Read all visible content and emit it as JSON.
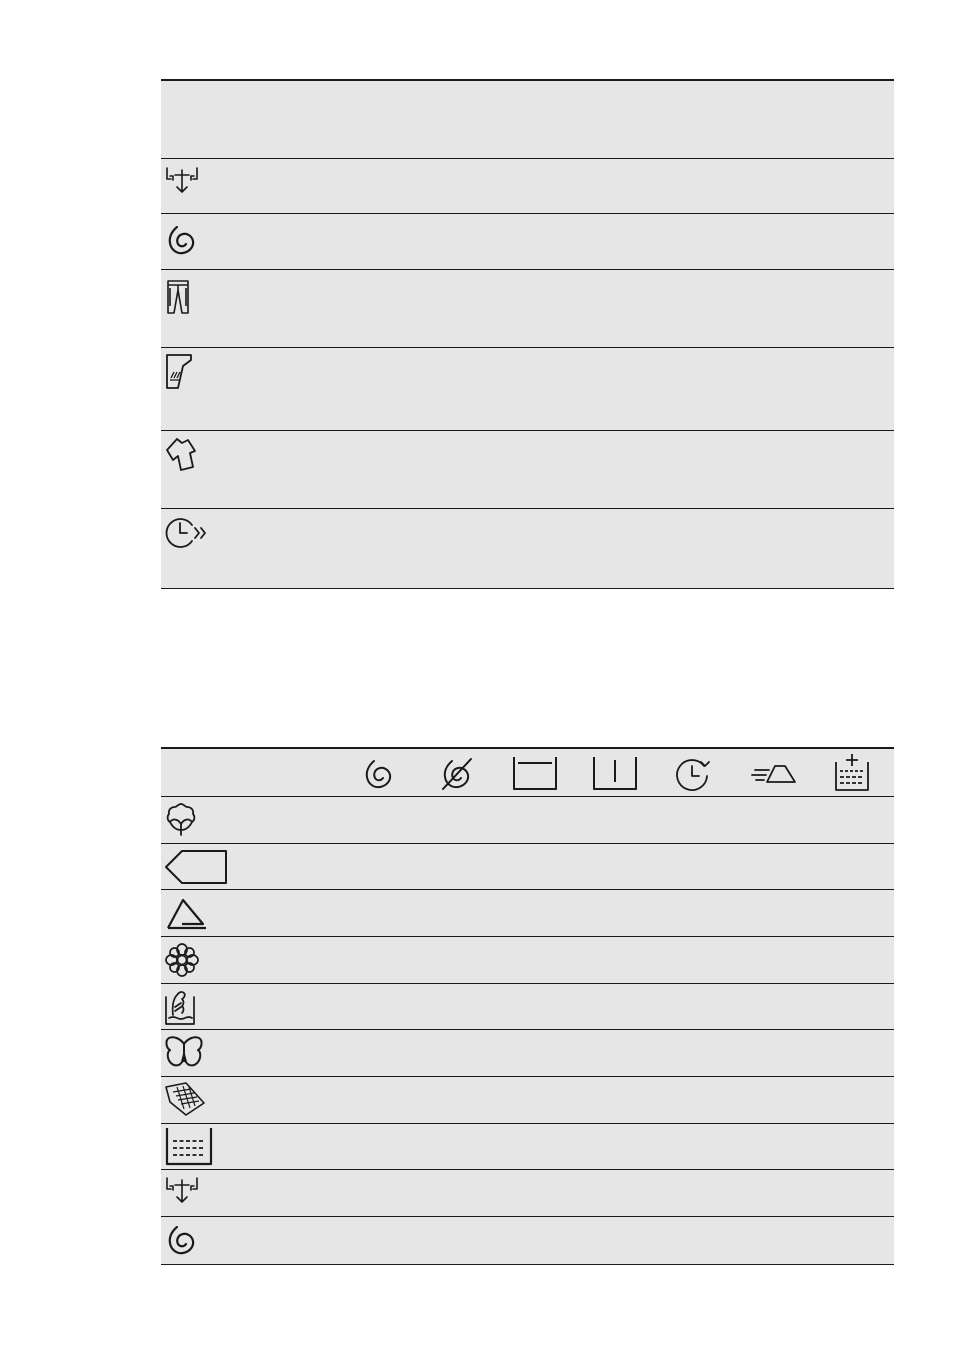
{
  "program_table": {
    "rows": [
      {
        "icon": "drain-icon"
      },
      {
        "icon": "spin-icon"
      },
      {
        "icon": "jeans-icon"
      },
      {
        "icon": "curtains-icon"
      },
      {
        "icon": "sportswear-icon"
      },
      {
        "icon": "quick-time-icon"
      }
    ]
  },
  "options_table": {
    "columns": [
      {
        "icon": "spin-icon"
      },
      {
        "icon": "no-spin-icon"
      },
      {
        "icon": "rinse-hold-icon"
      },
      {
        "icon": "start-pause-icon"
      },
      {
        "icon": "delay-start-icon"
      },
      {
        "icon": "easy-iron-icon"
      },
      {
        "icon": "extra-rinse-icon"
      }
    ],
    "rows": [
      {
        "icon": "eco-cotton-icon"
      },
      {
        "icon": "synthetics-icon"
      },
      {
        "icon": "mixed-icon"
      },
      {
        "icon": "delicates-icon"
      },
      {
        "icon": "wool-handwash-icon"
      },
      {
        "icon": "silk-icon"
      },
      {
        "icon": "duvet-icon"
      },
      {
        "icon": "rinse-icon"
      },
      {
        "icon": "drain-icon"
      },
      {
        "icon": "spin-icon"
      }
    ]
  }
}
